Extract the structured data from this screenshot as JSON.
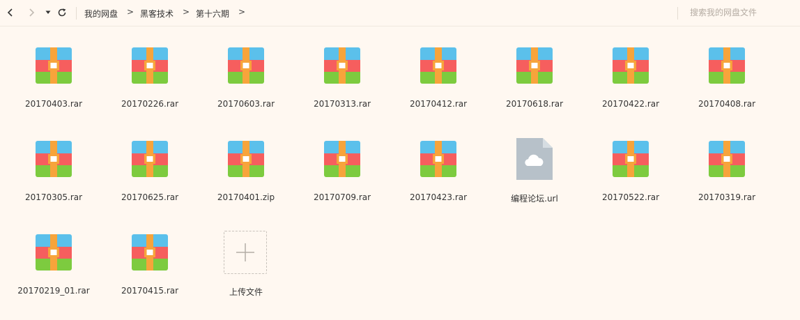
{
  "toolbar": {
    "breadcrumb": [
      "我的网盘",
      "黑客技术",
      "第十六期"
    ],
    "search_placeholder": "搜索我的网盘文件"
  },
  "colors": {
    "rar_top": "#5bc0eb",
    "rar_middle": "#f65e5e",
    "rar_bottom": "#7dcb3f",
    "rar_strap": "#f7a43b",
    "url_file": "#b7c1c9"
  },
  "files": [
    {
      "name": "20170403.rar",
      "type": "rar"
    },
    {
      "name": "20170226.rar",
      "type": "rar"
    },
    {
      "name": "20170603.rar",
      "type": "rar"
    },
    {
      "name": "20170313.rar",
      "type": "rar"
    },
    {
      "name": "20170412.rar",
      "type": "rar"
    },
    {
      "name": "20170618.rar",
      "type": "rar"
    },
    {
      "name": "20170422.rar",
      "type": "rar"
    },
    {
      "name": "20170408.rar",
      "type": "rar"
    },
    {
      "name": "20170305.rar",
      "type": "rar"
    },
    {
      "name": "20170625.rar",
      "type": "rar"
    },
    {
      "name": "20170401.zip",
      "type": "rar"
    },
    {
      "name": "20170709.rar",
      "type": "rar"
    },
    {
      "name": "20170423.rar",
      "type": "rar"
    },
    {
      "name": "编程论坛.url",
      "type": "url"
    },
    {
      "name": "20170522.rar",
      "type": "rar"
    },
    {
      "name": "20170319.rar",
      "type": "rar"
    },
    {
      "name": "20170219_01.rar",
      "type": "rar"
    },
    {
      "name": "20170415.rar",
      "type": "rar"
    }
  ],
  "upload": {
    "label": "上传文件"
  }
}
